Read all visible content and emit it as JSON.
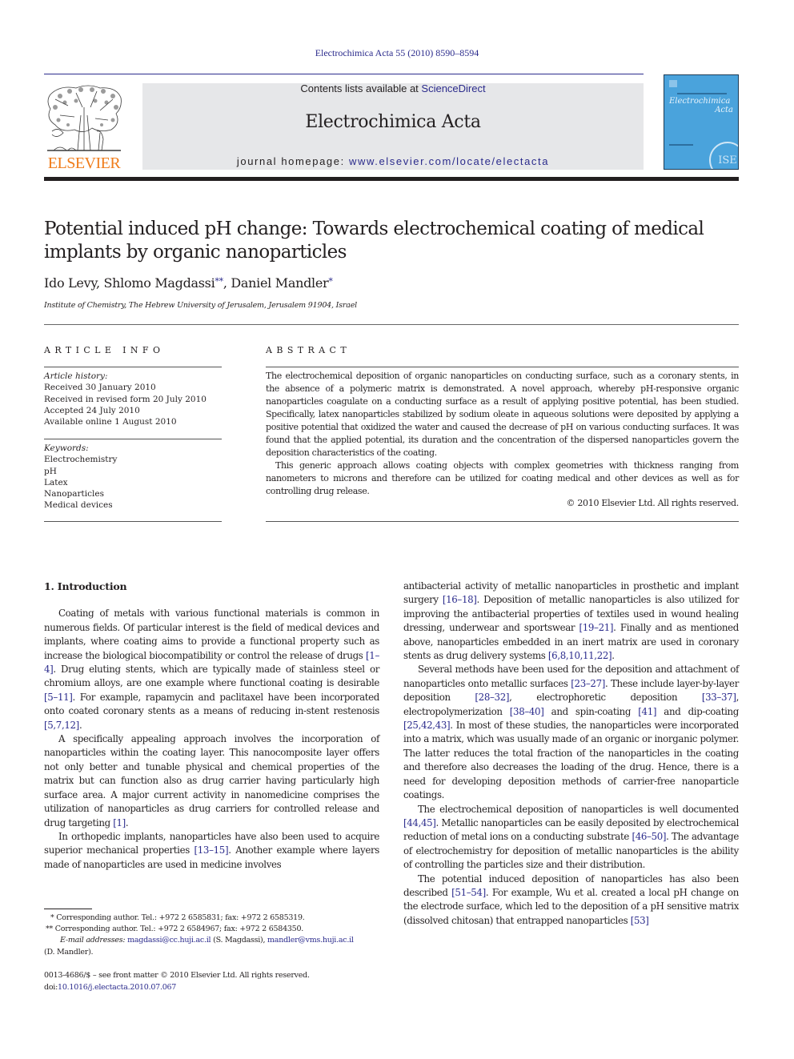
{
  "running_head": "Electrochimica Acta 55 (2010) 8590–8594",
  "masthead": {
    "publisher": "ELSEVIER",
    "contents_prefix": "Contents lists available at ",
    "contents_link": "ScienceDirect",
    "journal_name": "Electrochimica Acta",
    "homepage_prefix": "journal homepage: ",
    "homepage_link": "www.elsevier.com/locate/electacta",
    "cover": {
      "title_line1": "Electrochimica",
      "title_line2": "Acta",
      "seal": "ISE"
    },
    "colors": {
      "publisher_orange": "#f07c1a",
      "link_blue": "#2b2b8c",
      "masthead_gray": "#e6e7e9",
      "cover_blue": "#4aa3dc"
    }
  },
  "article": {
    "title": "Potential induced pH change: Towards electrochemical coating of medical implants by organic nanoparticles",
    "authors": [
      {
        "name": "Ido Levy",
        "mark": ""
      },
      {
        "name": "Shlomo Magdassi",
        "mark": "**"
      },
      {
        "name": "Daniel Mandler",
        "mark": "*"
      }
    ],
    "affiliation": "Institute of Chemistry, The Hebrew University of Jerusalem, Jerusalem 91904, Israel"
  },
  "article_info": {
    "heading": "ARTICLE INFO",
    "history_label": "Article history:",
    "history": [
      "Received 30 January 2010",
      "Received in revised form 20 July 2010",
      "Accepted 24 July 2010",
      "Available online 1 August 2010"
    ],
    "keywords_label": "Keywords:",
    "keywords": [
      "Electrochemistry",
      "pH",
      "Latex",
      "Nanoparticles",
      "Medical devices"
    ]
  },
  "abstract": {
    "heading": "ABSTRACT",
    "paragraphs": [
      "The electrochemical deposition of organic nanoparticles on conducting surface, such as a coronary stents, in the absence of a polymeric matrix is demonstrated. A novel approach, whereby pH-responsive organic nanoparticles coagulate on a conducting surface as a result of applying positive potential, has been studied. Specifically, latex nanoparticles stabilized by sodium oleate in aqueous solutions were deposited by applying a positive potential that oxidized the water and caused the decrease of pH on various conducting surfaces. It was found that the applied potential, its duration and the concentration of the dispersed nanoparticles govern the deposition characteristics of the coating.",
      "This generic approach allows coating objects with complex geometries with thickness ranging from nanometers to microns and therefore can be utilized for coating medical and other devices as well as for controlling drug release."
    ],
    "copyright": "© 2010 Elsevier Ltd. All rights reserved."
  },
  "body": {
    "section_heading": "1.  Introduction",
    "left_column": [
      [
        {
          "t": "Coating of metals with various functional materials is common in numerous fields. Of particular interest is the field of medical devices and implants, where coating aims to provide a functional property such as increase the biological biocompatibility or control the release of drugs "
        },
        {
          "c": "[1–4]"
        },
        {
          "t": ". Drug eluting stents, which are typically made of stainless steel or chromium alloys, are one example where functional coating is desirable "
        },
        {
          "c": "[5–11]"
        },
        {
          "t": ". For example, rapamycin and paclitaxel have been incorporated onto coated coronary stents as a means of reducing in-stent restenosis "
        },
        {
          "c": "[5,7,12]"
        },
        {
          "t": "."
        }
      ],
      [
        {
          "t": "A specifically appealing approach involves the incorporation of nanoparticles within the coating layer. This nanocomposite layer offers not only better and tunable physical and chemical properties of the matrix but can function also as drug carrier having particularly high surface area. A major current activity in nanomedicine comprises the utilization of nanoparticles as drug carriers for controlled release and drug targeting "
        },
        {
          "c": "[1]"
        },
        {
          "t": "."
        }
      ],
      [
        {
          "t": "In orthopedic implants, nanoparticles have also been used to acquire superior mechanical properties "
        },
        {
          "c": "[13–15]"
        },
        {
          "t": ". Another example where layers made of nanoparticles are used in medicine involves"
        }
      ]
    ],
    "right_column": [
      [
        {
          "t": "antibacterial activity of metallic nanoparticles in prosthetic and implant surgery "
        },
        {
          "c": "[16–18]"
        },
        {
          "t": ". Deposition of metallic nanoparticles is also utilized for improving the antibacterial properties of textiles used in wound healing dressing, underwear and sportswear "
        },
        {
          "c": "[19–21]"
        },
        {
          "t": ". Finally and as mentioned above, nanoparticles embedded in an inert matrix are used in coronary stents as drug delivery systems "
        },
        {
          "c": "[6,8,10,11,22]"
        },
        {
          "t": "."
        }
      ],
      [
        {
          "t": "Several methods have been used for the deposition and attachment of nanoparticles onto metallic surfaces "
        },
        {
          "c": "[23–27]"
        },
        {
          "t": ". These include layer-by-layer deposition "
        },
        {
          "c": "[28–32]"
        },
        {
          "t": ", electrophoretic deposition "
        },
        {
          "c": "[33–37]"
        },
        {
          "t": ", electropolymerization "
        },
        {
          "c": "[38–40]"
        },
        {
          "t": " and spin-coating "
        },
        {
          "c": "[41]"
        },
        {
          "t": " and dip-coating "
        },
        {
          "c": "[25,42,43]"
        },
        {
          "t": ". In most of these studies, the nanoparticles were incorporated into a matrix, which was usually made of an organic or inorganic polymer. The latter reduces the total fraction of the nanoparticles in the coating and therefore also decreases the loading of the drug. Hence, there is a need for developing deposition methods of carrier-free nanoparticle coatings."
        }
      ],
      [
        {
          "t": "The electrochemical deposition of nanoparticles is well documented "
        },
        {
          "c": "[44,45]"
        },
        {
          "t": ". Metallic nanoparticles can be easily deposited by electrochemical reduction of metal ions on a conducting substrate "
        },
        {
          "c": "[46–50]"
        },
        {
          "t": ". The advantage of electrochemistry for deposition of metallic nanoparticles is the ability of controlling the particles size and their distribution."
        }
      ],
      [
        {
          "t": "The potential induced deposition of nanoparticles has also been described "
        },
        {
          "c": "[51–54]"
        },
        {
          "t": ". For example, Wu et al. created a local pH change on the electrode surface, which led to the deposition of a pH sensitive matrix (dissolved chitosan) that entrapped nanoparticles "
        },
        {
          "c": "[53]"
        }
      ]
    ]
  },
  "footnotes": {
    "fn1": "*  Corresponding author. Tel.: +972 2 6585831; fax: +972 2 6585319.",
    "fn2": "**  Corresponding author. Tel.: +972 2 6584967; fax: +972 2 6584350.",
    "email_label": "E-mail addresses:",
    "email1": "magdassi@cc.huji.ac.il",
    "email1_owner": " (S. Magdassi), ",
    "email2": "mandler@vms.huji.ac.il",
    "email2_owner": "(D. Mandler)."
  },
  "front_matter": {
    "issn_line": "0013-4686/$ – see front matter © 2010 Elsevier Ltd. All rights reserved.",
    "doi_prefix": "doi:",
    "doi": "10.1016/j.electacta.2010.07.067"
  }
}
